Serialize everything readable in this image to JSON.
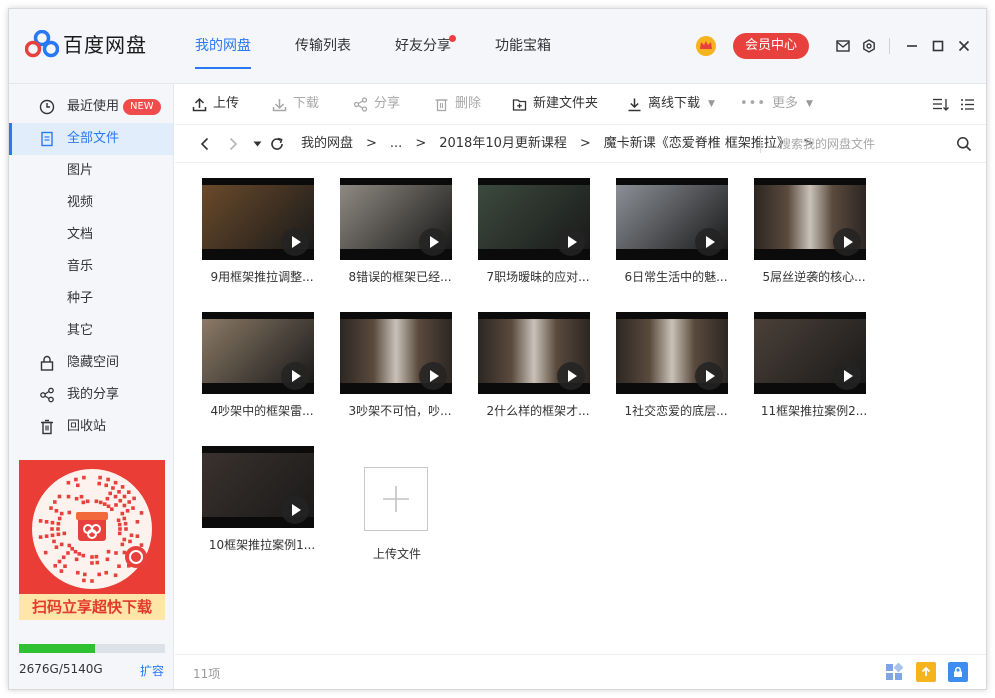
{
  "app": {
    "name": "百度网盘",
    "nav": [
      {
        "label": "我的网盘",
        "active": true
      },
      {
        "label": "传输列表"
      },
      {
        "label": "好友分享",
        "dot": true
      },
      {
        "label": "功能宝箱"
      }
    ],
    "vip_label": "会员中心",
    "icons": [
      "crown-icon",
      "mail-icon",
      "settings-icon",
      "minimize-icon",
      "maximize-icon",
      "close-icon"
    ]
  },
  "sidebar": {
    "items": [
      {
        "label": "最近使用",
        "icon": "clock-icon",
        "badge": "NEW"
      },
      {
        "label": "全部文件",
        "icon": "file-icon",
        "active": true
      },
      {
        "label": "图片"
      },
      {
        "label": "视频"
      },
      {
        "label": "文档"
      },
      {
        "label": "音乐"
      },
      {
        "label": "种子"
      },
      {
        "label": "其它"
      },
      {
        "label": "隐藏空间",
        "icon": "lock-icon"
      },
      {
        "label": "我的分享",
        "icon": "share-icon"
      },
      {
        "label": "回收站",
        "icon": "trash-icon"
      }
    ],
    "promo_text": "扫码立享超快下载",
    "quota_used_fraction": 0.52,
    "quota": "2676G/5140G",
    "expand_label": "扩容"
  },
  "toolbar": {
    "upload": "上传",
    "download": "下载",
    "share": "分享",
    "delete": "删除",
    "new_folder": "新建文件夹",
    "offline_download": "离线下载",
    "more": "更多"
  },
  "address": {
    "crumbs": [
      "我的网盘",
      "...",
      "2018年10月更新课程",
      "魔卡新课《恋爱脊椎 框架推拉》"
    ],
    "separator": ">",
    "search_placeholder": "搜索我的网盘文件"
  },
  "files": [
    {
      "name": "9用框架推拉调整...",
      "scene": "warm-street"
    },
    {
      "name": "8错误的框架已经...",
      "scene": "bedroom"
    },
    {
      "name": "7职场暧昧的应对...",
      "scene": "hands"
    },
    {
      "name": "6日常生活中的魅...",
      "scene": "outdoor"
    },
    {
      "name": "5屌丝逆袭的核心...",
      "scene": "lecture"
    },
    {
      "name": "4吵架中的框架雷...",
      "scene": "room"
    },
    {
      "name": "3吵架不可怕，吵...",
      "scene": "lecture"
    },
    {
      "name": "2什么样的框架才...",
      "scene": "lecture"
    },
    {
      "name": "1社交恋爱的底层...",
      "scene": "lecture"
    },
    {
      "name": "11框架推拉案例2...",
      "scene": "dark-room"
    },
    {
      "name": "10框架推拉案例1...",
      "scene": "closeup"
    }
  ],
  "upload_tile_label": "上传文件",
  "status": {
    "count": "11项"
  },
  "colors": {
    "accent": "#2a78f5",
    "vip": "#e8413d",
    "promo": "#ea3d35",
    "quota": "#2fc12f"
  }
}
